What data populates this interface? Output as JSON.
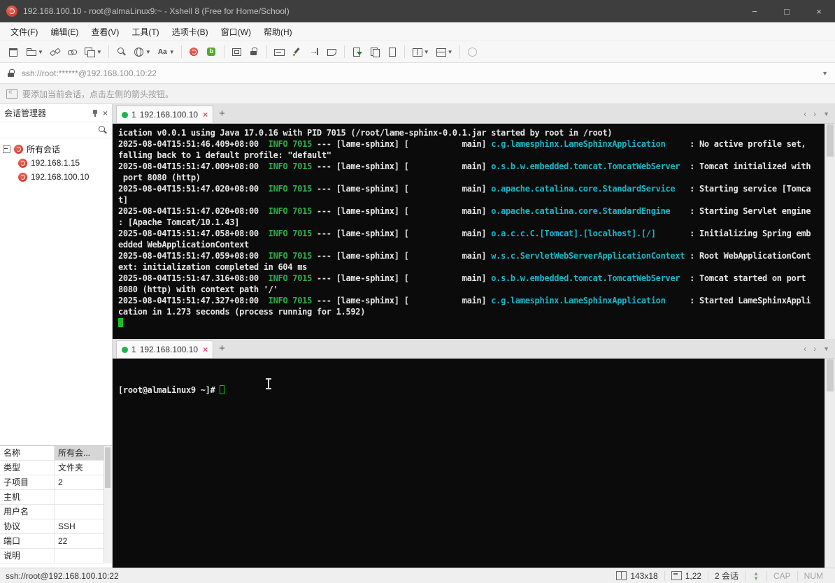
{
  "window": {
    "title": "192.168.100.10 - root@almaLinux9:~ - Xshell 8 (Free for Home/School)",
    "controls": {
      "minimize": "−",
      "maximize": "□",
      "close": "×"
    }
  },
  "menu": {
    "items": [
      "文件(F)",
      "编辑(E)",
      "查看(V)",
      "工具(T)",
      "选项卡(B)",
      "窗口(W)",
      "帮助(H)"
    ]
  },
  "toolbar": {
    "items": [
      {
        "name": "new-session-icon",
        "shape": "window",
        "caret": false
      },
      {
        "name": "open-folder-icon",
        "shape": "folder",
        "caret": true
      },
      {
        "name": "disconnect-icon",
        "shape": "disconnect",
        "caret": false
      },
      {
        "name": "reconnect-icon",
        "shape": "link",
        "caret": false
      },
      {
        "name": "new-window-icon",
        "shape": "window2",
        "caret": true
      },
      {
        "sep": true
      },
      {
        "name": "find-icon",
        "shape": "search-ic",
        "caret": false
      },
      {
        "name": "encoding-icon",
        "shape": "globe",
        "caret": true
      },
      {
        "name": "font-size-icon",
        "shape": "font-ic",
        "caret": true,
        "text": "Aa"
      },
      {
        "sep": true
      },
      {
        "name": "xshell-agent-icon",
        "shape": "xshell-ic",
        "caret": false
      },
      {
        "name": "xftp-icon",
        "shape": "xftp-ic",
        "caret": false
      },
      {
        "sep": true
      },
      {
        "name": "fullscreen-icon",
        "shape": "fullscreen",
        "caret": false
      },
      {
        "name": "lock-screen-icon",
        "shape": "lock-ic",
        "caret": false
      },
      {
        "sep": true
      },
      {
        "name": "compose-pane-icon",
        "shape": "kbd",
        "caret": false
      },
      {
        "name": "highlight-icon",
        "shape": "pen",
        "caret": false
      },
      {
        "name": "send-input-icon",
        "shape": "sendto",
        "caret": false
      },
      {
        "name": "quick-command-icon",
        "shape": "ruler",
        "caret": false
      },
      {
        "sep": true
      },
      {
        "name": "log-session-icon",
        "shape": "paper-export",
        "caret": false
      },
      {
        "name": "file-transfer-icon",
        "shape": "papers",
        "caret": false
      },
      {
        "name": "session-properties-icon",
        "shape": "paper",
        "caret": false
      },
      {
        "sep": true
      },
      {
        "name": "tile-vertically-icon",
        "shape": "grid-ic",
        "caret": true
      },
      {
        "name": "tile-horizontally-icon",
        "shape": "grid2-ic",
        "caret": true
      },
      {
        "sep": true
      },
      {
        "name": "help-icon",
        "shape": "circle-ic",
        "caret": false
      }
    ]
  },
  "address_bar": {
    "value": "ssh://root:******@192.168.100.10:22"
  },
  "hint_bar": {
    "text": "要添加当前会话，点击左侧的箭头按钮。"
  },
  "session_manager": {
    "title": "会话管理器",
    "root_label": "所有会话",
    "sessions": [
      "192.168.1.15",
      "192.168.100.10"
    ],
    "properties": [
      {
        "label": "名称",
        "value": "所有会..."
      },
      {
        "label": "类型",
        "value": "文件夹"
      },
      {
        "label": "子项目",
        "value": "2"
      },
      {
        "label": "主机",
        "value": ""
      },
      {
        "label": "用户名",
        "value": ""
      },
      {
        "label": "协议",
        "value": "SSH"
      },
      {
        "label": "端口",
        "value": "22"
      },
      {
        "label": "说明",
        "value": ""
      }
    ]
  },
  "panes": [
    {
      "tab_index": "1",
      "tab_label": "192.168.100.10"
    },
    {
      "tab_index": "1",
      "tab_label": "192.168.100.10"
    }
  ],
  "terminal1": {
    "lines": [
      {
        "segs": [
          [
            "w",
            "ication v0.0.1 using Java 17.0.16 with PID 7015 (/root/lame-sphinx-0.0.1.jar started by root in /root)"
          ]
        ]
      },
      {
        "segs": [
          [
            "w",
            "2025-08-04T15:51:46.409+08:00"
          ],
          [
            "g",
            "  INFO 7015"
          ],
          [
            "w",
            " --- [lame-sphinx] [           main] "
          ],
          [
            "c",
            "c.g.lamesphinx.LameSphinxApplication"
          ],
          [
            "w",
            "     : No active profile set,"
          ]
        ]
      },
      {
        "segs": [
          [
            "w",
            "falling back to 1 default profile: \"default\""
          ]
        ]
      },
      {
        "segs": [
          [
            "w",
            "2025-08-04T15:51:47.009+08:00"
          ],
          [
            "g",
            "  INFO 7015"
          ],
          [
            "w",
            " --- [lame-sphinx] [           main] "
          ],
          [
            "c",
            "o.s.b.w.embedded.tomcat.TomcatWebServer"
          ],
          [
            "w",
            "  : Tomcat initialized with"
          ]
        ]
      },
      {
        "segs": [
          [
            "w",
            " port 8080 (http)"
          ]
        ]
      },
      {
        "segs": [
          [
            "w",
            "2025-08-04T15:51:47.020+08:00"
          ],
          [
            "g",
            "  INFO 7015"
          ],
          [
            "w",
            " --- [lame-sphinx] [           main] "
          ],
          [
            "c",
            "o.apache.catalina.core.StandardService"
          ],
          [
            "w",
            "   : Starting service [Tomca"
          ]
        ]
      },
      {
        "segs": [
          [
            "w",
            "t]"
          ]
        ]
      },
      {
        "segs": [
          [
            "w",
            "2025-08-04T15:51:47.020+08:00"
          ],
          [
            "g",
            "  INFO 7015"
          ],
          [
            "w",
            " --- [lame-sphinx] [           main] "
          ],
          [
            "c",
            "o.apache.catalina.core.StandardEngine"
          ],
          [
            "w",
            "    : Starting Servlet engine"
          ]
        ]
      },
      {
        "segs": [
          [
            "w",
            ": [Apache Tomcat/10.1.43]"
          ]
        ]
      },
      {
        "segs": [
          [
            "w",
            "2025-08-04T15:51:47.058+08:00"
          ],
          [
            "g",
            "  INFO 7015"
          ],
          [
            "w",
            " --- [lame-sphinx] [           main] "
          ],
          [
            "c",
            "o.a.c.c.C.[Tomcat].[localhost].[/]"
          ],
          [
            "w",
            "       : Initializing Spring emb"
          ]
        ]
      },
      {
        "segs": [
          [
            "w",
            "edded WebApplicationContext"
          ]
        ]
      },
      {
        "segs": [
          [
            "w",
            "2025-08-04T15:51:47.059+08:00"
          ],
          [
            "g",
            "  INFO 7015"
          ],
          [
            "w",
            " --- [lame-sphinx] [           main] "
          ],
          [
            "c",
            "w.s.c.ServletWebServerApplicationContext"
          ],
          [
            "w",
            " : Root WebApplicationCont"
          ]
        ]
      },
      {
        "segs": [
          [
            "w",
            "ext: initialization completed in 604 ms"
          ]
        ]
      },
      {
        "segs": [
          [
            "w",
            "2025-08-04T15:51:47.316+08:00"
          ],
          [
            "g",
            "  INFO 7015"
          ],
          [
            "w",
            " --- [lame-sphinx] [           main] "
          ],
          [
            "c",
            "o.s.b.w.embedded.tomcat.TomcatWebServer"
          ],
          [
            "w",
            "  : Tomcat started on port"
          ]
        ]
      },
      {
        "segs": [
          [
            "w",
            "8080 (http) with context path '/'"
          ]
        ]
      },
      {
        "segs": [
          [
            "w",
            "2025-08-04T15:51:47.327+08:00"
          ],
          [
            "g",
            "  INFO 7015"
          ],
          [
            "w",
            " --- [lame-sphinx] [           main] "
          ],
          [
            "c",
            "c.g.lamesphinx.LameSphinxApplication"
          ],
          [
            "w",
            "     : Started LameSphinxAppli"
          ]
        ]
      },
      {
        "segs": [
          [
            "w",
            "cation in 1.273 seconds (process running for 1.592)"
          ]
        ]
      },
      {
        "cursor": "filled",
        "segs": []
      }
    ]
  },
  "terminal2": {
    "prompt": "[root@almaLinux9 ~]# "
  },
  "status_bar": {
    "connection": "ssh://root@192.168.100.10:22",
    "terminal_size": "143x18",
    "cursor_position": "1,22",
    "session_count": "2 会话",
    "cap_label": "CAP",
    "num_label": "NUM"
  },
  "colors": {
    "terminal_background": "#0b0b0b",
    "terminal_green": "#2fae4a",
    "terminal_cyan": "#19b6c9",
    "tab_dot_green": "#21b14b",
    "brand_red": "#c62f22"
  }
}
